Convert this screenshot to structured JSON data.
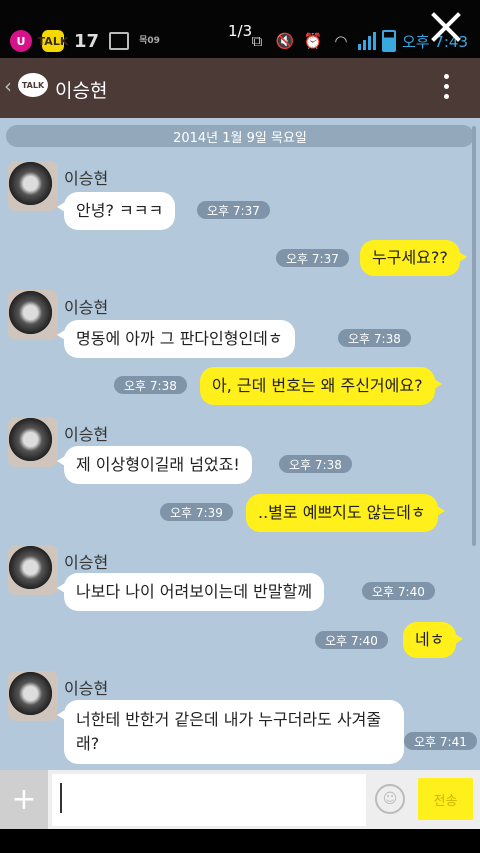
{
  "status_bar": {
    "counter": "1/3",
    "weather": "목09",
    "date_num": "17",
    "time": "오후 7:43"
  },
  "header": {
    "talk_label": "TALK",
    "title": "이승현"
  },
  "chat": {
    "date": "2014년 1월 9일 목요일",
    "sender_name": "이승현",
    "messages": [
      {
        "from": "other",
        "text": "안녕? ㅋㅋㅋ",
        "time": "오후 7:37"
      },
      {
        "from": "me",
        "text": "누구세요??",
        "time": "오후 7:37"
      },
      {
        "from": "other",
        "text": "명동에 아까 그 판다인형인데ㅎ",
        "time": "오후 7:38"
      },
      {
        "from": "me",
        "text": "아, 근데 번호는 왜 주신거에요?",
        "time": "오후 7:38"
      },
      {
        "from": "other",
        "text": "제 이상형이길래 넘었죠!",
        "time": "오후 7:38"
      },
      {
        "from": "me",
        "text": "..별로 예쁘지도 않는데ㅎ",
        "time": "오후 7:39"
      },
      {
        "from": "other",
        "text": "나보다 나이 어려보이는데 반말할께",
        "time": "오후 7:40"
      },
      {
        "from": "me",
        "text": "네ㅎ",
        "time": "오후 7:40"
      },
      {
        "from": "other",
        "text": "너한테 반한거 같은데 내가 누구더라도 사겨줄래?",
        "time": "오후 7:41"
      }
    ]
  },
  "input": {
    "plus_label": "+",
    "placeholder": "",
    "send_label": "전송"
  },
  "colors": {
    "chat_bg": "#b3c8da",
    "header_bg": "#4b3a35",
    "my_bubble": "#ffef1b",
    "other_bubble": "#ffffff"
  }
}
